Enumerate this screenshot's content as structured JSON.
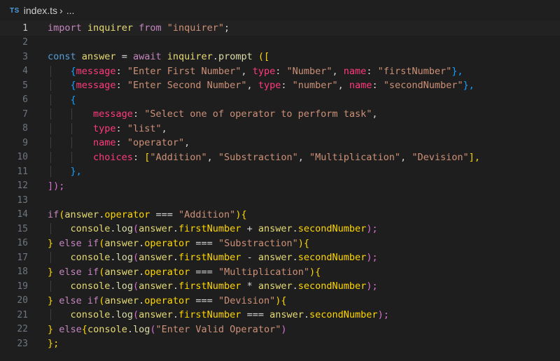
{
  "breadcrumb": {
    "lang_badge": "TS",
    "file": "index.ts",
    "more": "..."
  },
  "lines": [
    "1",
    "2",
    "3",
    "4",
    "5",
    "6",
    "7",
    "8",
    "9",
    "10",
    "11",
    "12",
    "13",
    "14",
    "15",
    "16",
    "17",
    "18",
    "19",
    "20",
    "21",
    "22",
    "23"
  ],
  "code": {
    "l1": [
      "import",
      "inquirer",
      "from",
      "\"inquirer\"",
      ";"
    ],
    "l3": [
      "const",
      "answer",
      "=",
      "await",
      "inquirer",
      ".",
      "prompt",
      "(["
    ],
    "l4": [
      "{",
      "message",
      ":",
      "\"Enter First Number\"",
      ",",
      "type",
      ":",
      "\"Number\"",
      ",",
      "name",
      ":",
      "\"firstNumber\"",
      "},"
    ],
    "l5": [
      "{",
      "message",
      ":",
      "\"Enter Second Number\"",
      ",",
      "type",
      ":",
      "\"number\"",
      ",",
      "name",
      ":",
      "\"secondNumber\"",
      "},"
    ],
    "l6": [
      "{"
    ],
    "l7": [
      "message",
      ":",
      "\"Select one of operator to perform task\"",
      ","
    ],
    "l8": [
      "type",
      ":",
      "\"list\"",
      ","
    ],
    "l9": [
      "name",
      ":",
      "\"operator\"",
      ","
    ],
    "l10": [
      "choices",
      ":",
      "[",
      "\"Addition\"",
      ",",
      "\"Substraction\"",
      ",",
      "\"Multiplication\"",
      ",",
      "\"Devision\"",
      "],"
    ],
    "l11": [
      "},"
    ],
    "l12": [
      "]);"
    ],
    "l14": [
      "if",
      "(",
      "answer",
      ".",
      "operator",
      "===",
      "\"Addition\"",
      "){"
    ],
    "l15": [
      "console",
      ".",
      "log",
      "(",
      "answer",
      ".",
      "firstNumber",
      "+",
      "answer",
      ".",
      "secondNumber",
      ");"
    ],
    "l16": [
      "}",
      "else if",
      "(",
      "answer",
      ".",
      "operator",
      "===",
      "\"Substraction\"",
      "){"
    ],
    "l17": [
      "console",
      ".",
      "log",
      "(",
      "answer",
      ".",
      "firstNumber",
      "-",
      "answer",
      ".",
      "secondNumber",
      ");"
    ],
    "l18": [
      "}",
      "else if",
      "(",
      "answer",
      ".",
      "operator",
      "===",
      "\"Multiplication\"",
      "){"
    ],
    "l19": [
      "console",
      ".",
      "log",
      "(",
      "answer",
      ".",
      "firstNumber",
      "*",
      "answer",
      ".",
      "secondNumber",
      ");"
    ],
    "l20": [
      "}",
      "else if",
      "(",
      "answer",
      ".",
      "operator",
      "===",
      "\"Devision\"",
      "){"
    ],
    "l21": [
      "console",
      ".",
      "log",
      "(",
      "answer",
      ".",
      "firstNumber",
      "===",
      "answer",
      ".",
      "secondNumber",
      ");"
    ],
    "l22": [
      "}",
      "else",
      "{",
      "console",
      ".",
      "log",
      "(",
      "\"Enter Valid Operator\"",
      ")"
    ],
    "l23": [
      "};"
    ]
  }
}
